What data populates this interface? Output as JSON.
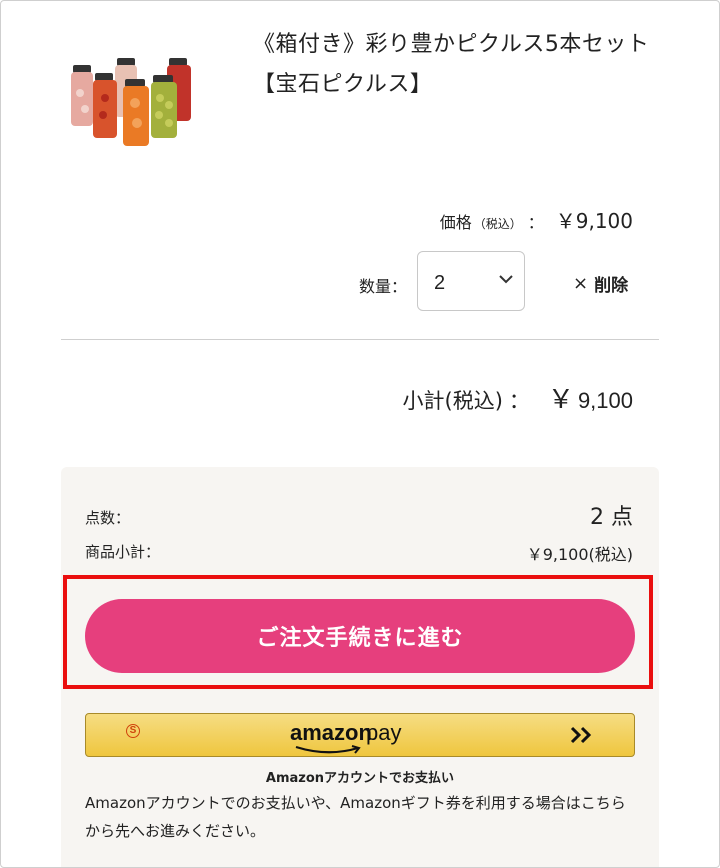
{
  "product": {
    "title": "《箱付き》彩り豊かピクルス5本セット【宝石ピクルス】",
    "price_label": "価格",
    "price_tax_note": "（税込）",
    "price_colon": "：",
    "price_value": "￥9,100",
    "qty_label": "数量：",
    "qty_value": "2",
    "delete_label": "削除",
    "delete_mark": "×"
  },
  "subtotal": {
    "label": "小計(税込)",
    "colon": "：",
    "yen": "￥",
    "value": "9,100"
  },
  "summary": {
    "count_label": "点数：",
    "count_value": "2 点",
    "items_subtotal_label": "商品小計：",
    "items_subtotal_value": "￥9,100(税込)"
  },
  "checkout_button": "ご注文手続きに進む",
  "amazon_pay": {
    "logo_word1": "amazon",
    "logo_word2": "pay",
    "coin_mark": "S",
    "caption": "Amazonアカウントでお支払い",
    "description": "Amazonアカウントでのお支払いや、Amazonギフト券を利用する場合はこちらから先へお進みください。"
  },
  "colors": {
    "accent_pink": "#e63f7d",
    "highlight_red": "#ea0e0e",
    "amazon_yellow": "#efc63e",
    "summary_bg": "#f7f5f2"
  },
  "icons": [
    "chevron-down-icon",
    "double-chevron-right-icon",
    "amazon-smile-logo",
    "amazon-coin-icon"
  ]
}
